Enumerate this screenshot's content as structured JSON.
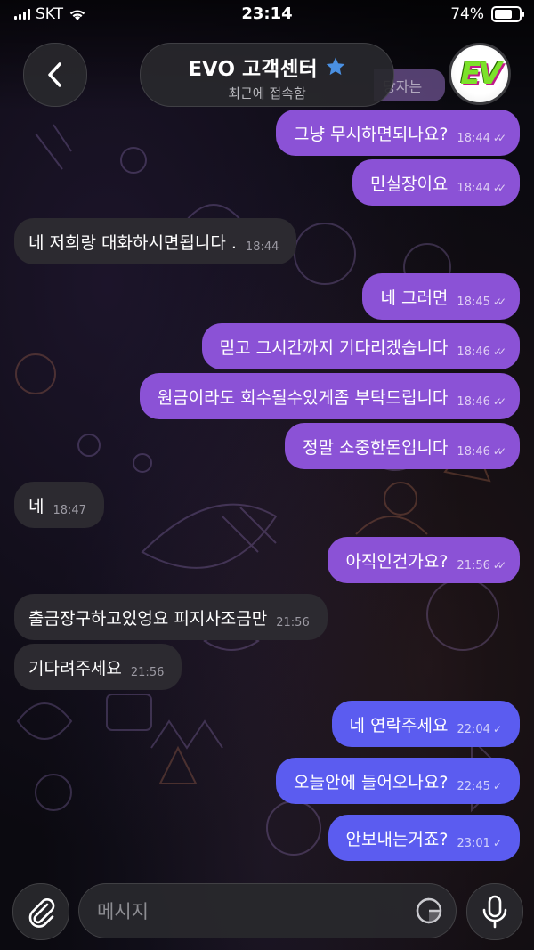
{
  "status_bar": {
    "carrier": "SKT",
    "time": "23:14",
    "battery": "74%",
    "battery_level": 0.74
  },
  "header": {
    "title": "EVO 고객센터",
    "subtitle": "최근에 접속함",
    "avatar_text": "EV",
    "partial_text": "당자는"
  },
  "messages": [
    {
      "text": "그냥 무시하면되나요?",
      "time": "18:44",
      "direction": "out",
      "status": "read"
    },
    {
      "text": "민실장이요",
      "time": "18:44",
      "direction": "out",
      "status": "read"
    },
    {
      "text": "네 저희랑 대화하시면됩니다 .",
      "time": "18:44",
      "direction": "in"
    },
    {
      "text": "네 그러면",
      "time": "18:45",
      "direction": "out",
      "status": "read"
    },
    {
      "text": "믿고 그시간까지 기다리겠습니다",
      "time": "18:46",
      "direction": "out",
      "status": "read"
    },
    {
      "text": "원금이라도 회수될수있게좀 부탁드립니다",
      "time": "18:46",
      "direction": "out",
      "status": "read"
    },
    {
      "text": "정말 소중한돈입니다",
      "time": "18:46",
      "direction": "out",
      "status": "read"
    },
    {
      "text": "네",
      "time": "18:47",
      "direction": "in"
    },
    {
      "text": "아직인건가요?",
      "time": "21:56",
      "direction": "out",
      "status": "read"
    },
    {
      "text": "출금장구하고있엉요 피지사조금만",
      "time": "21:56",
      "direction": "in"
    },
    {
      "text": "기다려주세요",
      "time": "21:56",
      "direction": "in"
    },
    {
      "text": "네 연락주세요",
      "time": "22:04",
      "direction": "out",
      "status": "sent"
    },
    {
      "text": "오늘안에 들어오나요?",
      "time": "22:45",
      "direction": "out",
      "status": "sent"
    },
    {
      "text": "안보내는거죠?",
      "time": "23:01",
      "direction": "out",
      "status": "sent"
    }
  ],
  "input": {
    "placeholder": "메시지"
  },
  "icons": {
    "back": "chevron-left-icon",
    "verified": "star-icon",
    "attach": "paperclip-icon",
    "sticker": "sticker-icon",
    "mic": "microphone-icon",
    "wifi": "wifi-icon"
  },
  "colors": {
    "outgoing_read": "#8b52d6",
    "outgoing_sent": "#5b5cf0",
    "incoming": "#2c2a30",
    "verified_star": "#4a90e2"
  }
}
